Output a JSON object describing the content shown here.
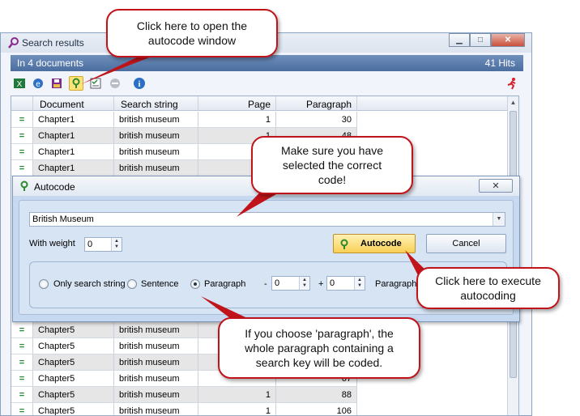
{
  "window": {
    "title": "Search results",
    "documents_label": "In 4 documents",
    "hits_label": "41 Hits"
  },
  "toolbar": {
    "icons": [
      "excel-icon",
      "explorer-icon",
      "save-icon",
      "autocode-icon",
      "checklist-icon",
      "disabled-icon",
      "info-icon"
    ],
    "selected": "autocode-icon"
  },
  "grid": {
    "columns": [
      "",
      "Document",
      "Search string",
      "Page",
      "Paragraph"
    ],
    "rows_top": [
      {
        "mark": "=",
        "document": "Chapter1",
        "search": "british museum",
        "page": "1",
        "paragraph": "30"
      },
      {
        "mark": "=",
        "document": "Chapter1",
        "search": "british museum",
        "page": "1",
        "paragraph": "48"
      },
      {
        "mark": "=",
        "document": "Chapter1",
        "search": "british museum",
        "page": "",
        "paragraph": ""
      },
      {
        "mark": "=",
        "document": "Chapter1",
        "search": "british museum",
        "page": "",
        "paragraph": ""
      }
    ],
    "rows_bottom": [
      {
        "mark": "=",
        "document": "Chapter5",
        "search": "british museum",
        "page": "",
        "paragraph": ""
      },
      {
        "mark": "=",
        "document": "Chapter5",
        "search": "british museum",
        "page": "",
        "paragraph": ""
      },
      {
        "mark": "=",
        "document": "Chapter5",
        "search": "british museum",
        "page": "",
        "paragraph": ""
      },
      {
        "mark": "=",
        "document": "Chapter5",
        "search": "british museum",
        "page": "",
        "paragraph": "67"
      },
      {
        "mark": "=",
        "document": "Chapter5",
        "search": "british museum",
        "page": "1",
        "paragraph": "88"
      },
      {
        "mark": "=",
        "document": "Chapter5",
        "search": "british museum",
        "page": "1",
        "paragraph": "106"
      }
    ]
  },
  "dialog": {
    "title": "Autocode",
    "close_label": "✕",
    "code_value": "British Museum",
    "weight_label": "With weight",
    "weight_value": "0",
    "autocode_label": "Autocode",
    "cancel_label": "Cancel",
    "options": {
      "only_search": "Only search string",
      "sentence": "Sentence",
      "paragraph": "Paragraph",
      "selected": "paragraph"
    },
    "minus_label": "-",
    "minus_value": "0",
    "plus_label": "+",
    "plus_value": "0",
    "range_label": "Paragraph"
  },
  "callouts": {
    "open_autocode": "Click here to open the autocode window",
    "select_code": "Make sure you have selected the correct code!",
    "execute": "Click here to execute autocoding",
    "paragraph_info": "If you choose 'paragraph', the whole paragraph containing a search key will be coded."
  },
  "colors": {
    "callout_border": "#c0141a",
    "banner": "#5a7cab",
    "dialog_bg": "#c6d9f0",
    "autocode_button": "#f8d056"
  }
}
